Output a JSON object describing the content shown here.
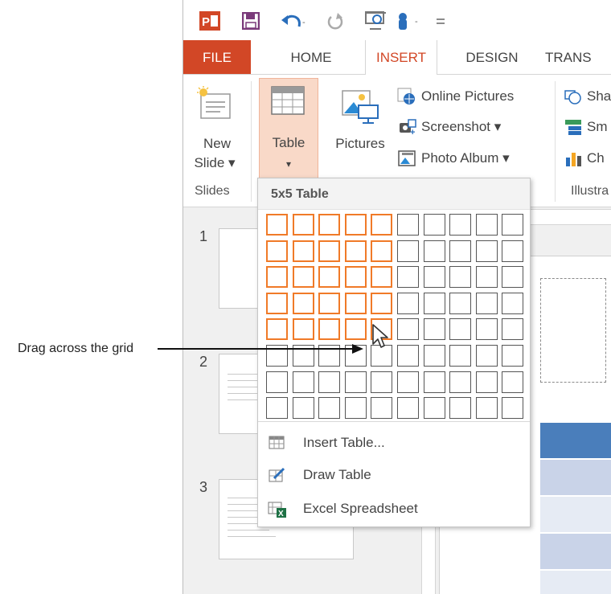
{
  "qat": {
    "icons": [
      "powerpoint-logo-icon",
      "save-icon",
      "undo-icon",
      "redo-icon",
      "from-beginning-icon",
      "touch-mode-icon",
      "customize-qat-icon"
    ]
  },
  "tabs": [
    {
      "label": "FILE"
    },
    {
      "label": "HOME"
    },
    {
      "label": "INSERT"
    },
    {
      "label": "DESIGN"
    },
    {
      "label": "TRANS"
    }
  ],
  "ribbon": {
    "new_slide": {
      "line1": "New",
      "line2": "Slide ▾"
    },
    "table": {
      "label": "Table",
      "arrow": "▾"
    },
    "pictures": {
      "label": "Pictures"
    },
    "online_pictures": "Online Pictures",
    "screenshot": "Screenshot ▾",
    "photo_album": "Photo Album  ▾",
    "shapes": "Sha",
    "smartart": "Sm",
    "chart": "Ch",
    "groups": {
      "slides": "Slides",
      "illustrations": "Illustra"
    }
  },
  "slides": [
    {
      "number": "1"
    },
    {
      "number": "2"
    },
    {
      "number": "3"
    }
  ],
  "dropdown": {
    "header": "5x5 Table",
    "grid": {
      "columns": 10,
      "rows": 8,
      "selected_columns": 5,
      "selected_rows": 5
    },
    "items": [
      {
        "label": "Insert Table...",
        "icon": "insert-table-icon"
      },
      {
        "label": "Draw Table",
        "icon": "draw-table-icon"
      },
      {
        "label": "Excel Spreadsheet",
        "icon": "excel-spreadsheet-icon"
      }
    ]
  },
  "callout": {
    "text": "Drag across the grid"
  },
  "colors": {
    "accent": "#d24726",
    "selection": "#f07a28",
    "table_header": "#4a7ebb",
    "table_band": "#c9d3e8"
  }
}
